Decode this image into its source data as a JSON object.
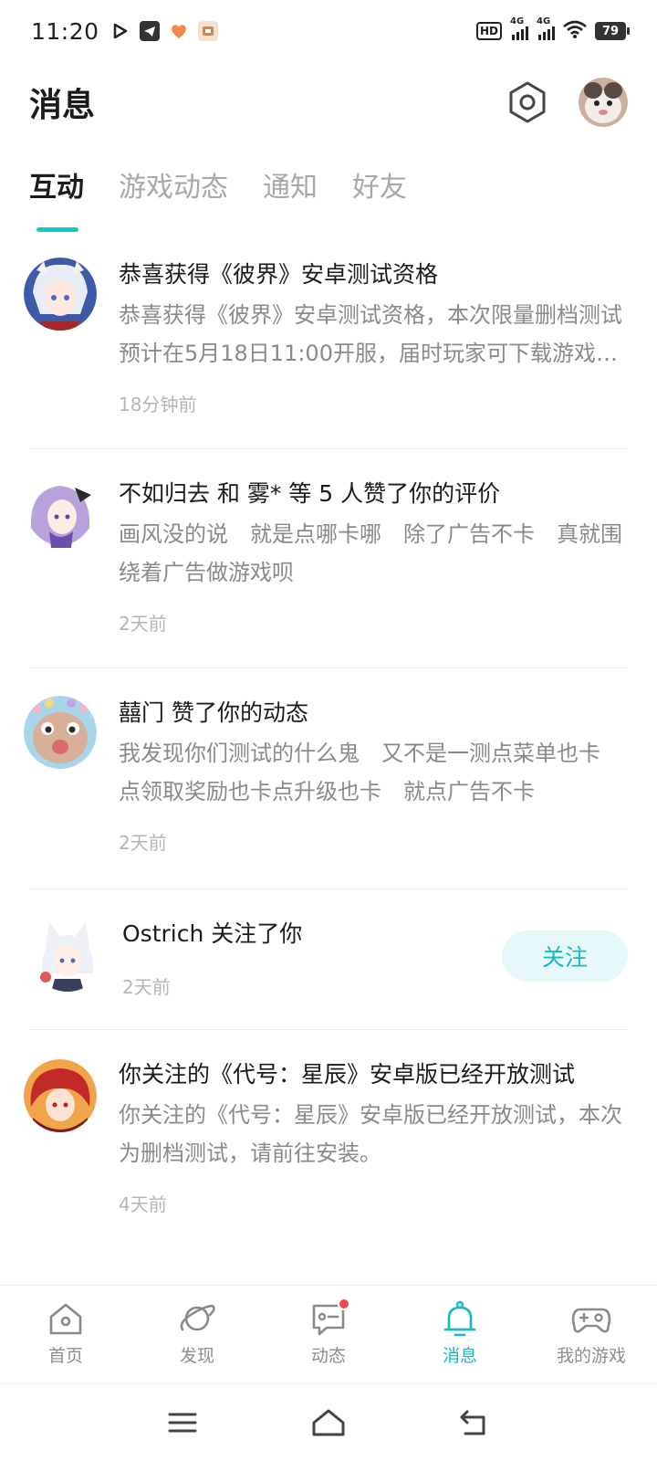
{
  "status_bar": {
    "time": "11:20",
    "battery": "79",
    "hd_label": "HD",
    "network_1": "4G",
    "network_2": "4G",
    "icons": [
      "play-icon",
      "telegram-icon",
      "heart-icon",
      "app-icon",
      "wifi-icon"
    ]
  },
  "header": {
    "title": "消息",
    "settings_icon": "hexagon-settings-icon"
  },
  "tabs": [
    {
      "label": "互动",
      "active": true
    },
    {
      "label": "游戏动态",
      "active": false
    },
    {
      "label": "通知",
      "active": false
    },
    {
      "label": "好友",
      "active": false
    }
  ],
  "messages": [
    {
      "title": "恭喜获得《彼界》安卓测试资格",
      "text": "恭喜获得《彼界》安卓测试资格，本次限量删档测试预计在5月18日11:00开服，届时玩家可下载游戏参与测试",
      "time": "18分钟前"
    },
    {
      "title": "不如归去 和 雾* 等 5 人赞了你的评价",
      "text": "画风没的说　就是点哪卡哪　除了广告不卡　真就围绕着广告做游戏呗",
      "time": "2天前"
    },
    {
      "title": "囍门 赞了你的动态",
      "text": "我发现你们测试的什么鬼　又不是一测点菜单也卡　点领取奖励也卡点升级也卡　就点广告不卡",
      "time": "2天前"
    },
    {
      "title": "Ostrich 关注了你",
      "time": "2天前",
      "follow_label": "关注"
    },
    {
      "title": "你关注的《代号：星辰》安卓版已经开放测试",
      "text": "你关注的《代号：星辰》安卓版已经开放测试，本次为删档测试，请前往安装。",
      "time": "4天前"
    }
  ],
  "bottom_nav": [
    {
      "label": "首页",
      "icon": "home-icon"
    },
    {
      "label": "发现",
      "icon": "planet-icon"
    },
    {
      "label": "动态",
      "icon": "chat-icon",
      "badge": true
    },
    {
      "label": "消息",
      "icon": "bell-icon",
      "active": true
    },
    {
      "label": "我的游戏",
      "icon": "gamepad-icon"
    }
  ],
  "colors": {
    "accent": "#14bac4",
    "badge": "#f04848",
    "muted_text": "#8a8a8a",
    "time_text": "#b5b5b5"
  }
}
